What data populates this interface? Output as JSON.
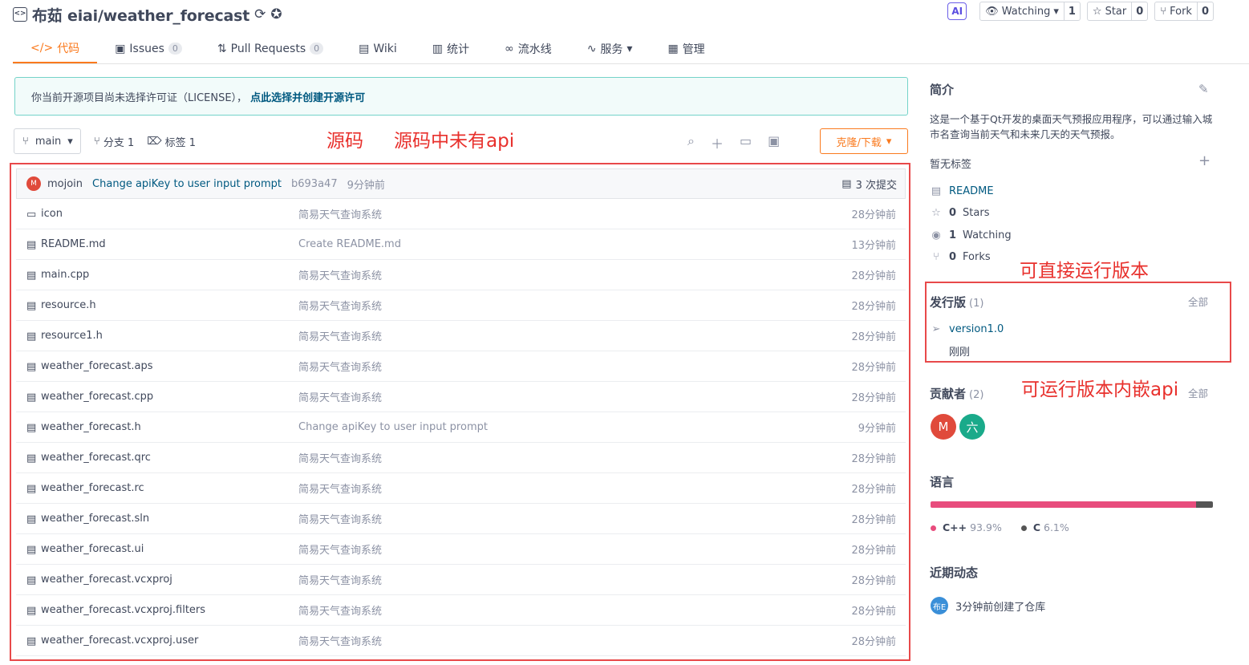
{
  "header": {
    "repo_title": "布茹 eiai/weather_forecast",
    "ai_badge": "AI",
    "watching_label": "Watching",
    "watching_count": "1",
    "star_label": "Star",
    "star_count": "0",
    "fork_label": "Fork",
    "fork_count": "0"
  },
  "tabs": [
    {
      "label": "代码",
      "badge": ""
    },
    {
      "label": "Issues",
      "badge": "0"
    },
    {
      "label": "Pull Requests",
      "badge": "0"
    },
    {
      "label": "Wiki",
      "badge": ""
    },
    {
      "label": "统计",
      "badge": ""
    },
    {
      "label": "流水线",
      "badge": ""
    },
    {
      "label": "服务",
      "badge": ""
    },
    {
      "label": "管理",
      "badge": ""
    }
  ],
  "notice": {
    "text": "你当前开源项目尚未选择许可证（LICENSE），",
    "link": "点此选择并创建开源许可"
  },
  "branchbar": {
    "branch": "main",
    "branches": "分支 1",
    "tags": "标签 1",
    "clone": "克隆/下载"
  },
  "annotations": {
    "source": "源码",
    "no_api": "源码中未有api",
    "runnable": "可直接运行版本",
    "embedded_api": "可运行版本内嵌api"
  },
  "commit": {
    "avatar": "M",
    "author": "mojoin",
    "message": "Change apiKey to user input prompt",
    "sha": "b693a47",
    "time": "9分钟前",
    "count": "3 次提交"
  },
  "files": [
    {
      "name": "icon",
      "msg": "简易天气查询系统",
      "time": "28分钟前",
      "type": "folder"
    },
    {
      "name": "README.md",
      "msg": "Create README.md",
      "time": "13分钟前",
      "type": "file"
    },
    {
      "name": "main.cpp",
      "msg": "简易天气查询系统",
      "time": "28分钟前",
      "type": "file"
    },
    {
      "name": "resource.h",
      "msg": "简易天气查询系统",
      "time": "28分钟前",
      "type": "file"
    },
    {
      "name": "resource1.h",
      "msg": "简易天气查询系统",
      "time": "28分钟前",
      "type": "file"
    },
    {
      "name": "weather_forecast.aps",
      "msg": "简易天气查询系统",
      "time": "28分钟前",
      "type": "file"
    },
    {
      "name": "weather_forecast.cpp",
      "msg": "简易天气查询系统",
      "time": "28分钟前",
      "type": "file"
    },
    {
      "name": "weather_forecast.h",
      "msg": "Change apiKey to user input prompt",
      "time": "9分钟前",
      "type": "file"
    },
    {
      "name": "weather_forecast.qrc",
      "msg": "简易天气查询系统",
      "time": "28分钟前",
      "type": "file"
    },
    {
      "name": "weather_forecast.rc",
      "msg": "简易天气查询系统",
      "time": "28分钟前",
      "type": "file"
    },
    {
      "name": "weather_forecast.sln",
      "msg": "简易天气查询系统",
      "time": "28分钟前",
      "type": "file"
    },
    {
      "name": "weather_forecast.ui",
      "msg": "简易天气查询系统",
      "time": "28分钟前",
      "type": "file"
    },
    {
      "name": "weather_forecast.vcxproj",
      "msg": "简易天气查询系统",
      "time": "28分钟前",
      "type": "file"
    },
    {
      "name": "weather_forecast.vcxproj.filters",
      "msg": "简易天气查询系统",
      "time": "28分钟前",
      "type": "file"
    },
    {
      "name": "weather_forecast.vcxproj.user",
      "msg": "简易天气查询系统",
      "time": "28分钟前",
      "type": "file"
    }
  ],
  "sidebar": {
    "intro_title": "简介",
    "description": "这是一个基于Qt开发的桌面天气预报应用程序，可以通过输入城市名查询当前天气和未来几天的天气预报。",
    "no_tags": "暂无标签",
    "readme": "README",
    "stars_count": "0",
    "stars_label": "Stars",
    "watching_count": "1",
    "watching_label": "Watching",
    "forks_count": "0",
    "forks_label": "Forks",
    "releases_title": "发行版",
    "releases_count": "(1)",
    "all": "全部",
    "release_name": "version1.0",
    "release_time": "刚刚",
    "contributors_title": "贡献者",
    "contributors_count": "(2)",
    "contributors": [
      "M",
      "六"
    ],
    "languages_title": "语言",
    "languages": [
      {
        "name": "C++",
        "percent": "93.9%",
        "color": "#e84c7d",
        "value": 93.9
      },
      {
        "name": "C",
        "percent": "6.1%",
        "color": "#555555",
        "value": 6.1
      }
    ],
    "activity_title": "近期动态",
    "activity_avatar": "布E",
    "activity_text": "3分钟前创建了仓库"
  },
  "colors": {
    "accent": "#fa7a1e",
    "link": "#005980",
    "annotation": "#e8302c"
  }
}
